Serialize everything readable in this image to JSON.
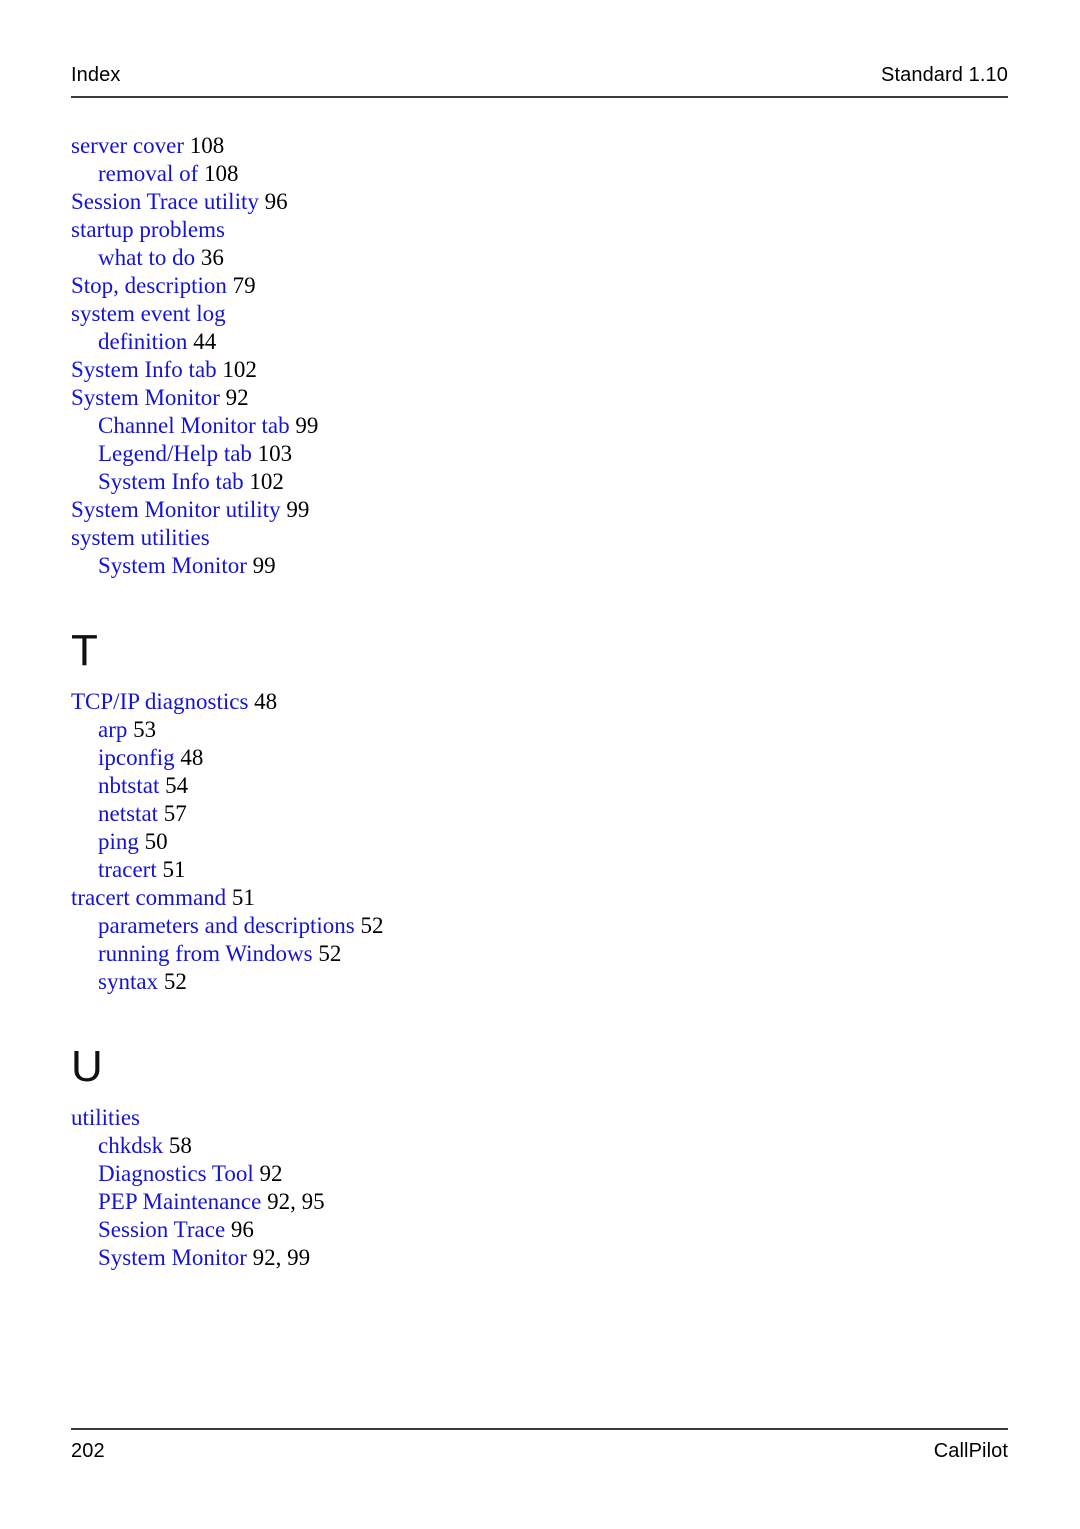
{
  "header": {
    "left": "Index",
    "right": "Standard 1.10"
  },
  "footer": {
    "left": "202",
    "right": "CallPilot"
  },
  "colors": {
    "entry_blue": "#1414d2",
    "page_number_black": "#000000",
    "rule_gray": "#3a3a3a"
  },
  "index": {
    "blocks": [
      {
        "type": "entries",
        "items": [
          {
            "label": "server cover",
            "pages": "108",
            "level": 0
          },
          {
            "label": "removal of",
            "pages": "108",
            "level": 1
          },
          {
            "label": "Session Trace utility",
            "pages": "96",
            "level": 0
          },
          {
            "label": "startup problems",
            "pages": "",
            "level": 0
          },
          {
            "label": "what to do",
            "pages": "36",
            "level": 1
          },
          {
            "label": "Stop, description",
            "pages": "79",
            "level": 0
          },
          {
            "label": "system event log",
            "pages": "",
            "level": 0
          },
          {
            "label": "definition",
            "pages": "44",
            "level": 1
          },
          {
            "label": "System Info tab",
            "pages": "102",
            "level": 0
          },
          {
            "label": "System Monitor",
            "pages": "92",
            "level": 0
          },
          {
            "label": "Channel Monitor tab",
            "pages": "99",
            "level": 1
          },
          {
            "label": "Legend/Help tab",
            "pages": "103",
            "level": 1
          },
          {
            "label": "System Info tab",
            "pages": "102",
            "level": 1
          },
          {
            "label": "System Monitor utility",
            "pages": "99",
            "level": 0
          },
          {
            "label": "system utilities",
            "pages": "",
            "level": 0
          },
          {
            "label": "System Monitor",
            "pages": "99",
            "level": 1
          }
        ]
      },
      {
        "type": "letter",
        "letter": "T"
      },
      {
        "type": "entries",
        "items": [
          {
            "label": "TCP/IP diagnostics",
            "pages": "48",
            "level": 0
          },
          {
            "label": "arp",
            "pages": "53",
            "level": 1
          },
          {
            "label": "ipconfig",
            "pages": "48",
            "level": 1
          },
          {
            "label": "nbtstat",
            "pages": "54",
            "level": 1
          },
          {
            "label": "netstat",
            "pages": "57",
            "level": 1
          },
          {
            "label": "ping",
            "pages": "50",
            "level": 1
          },
          {
            "label": "tracert",
            "pages": "51",
            "level": 1
          },
          {
            "label": "tracert command",
            "pages": "51",
            "level": 0
          },
          {
            "label": "parameters and descriptions",
            "pages": "52",
            "level": 1
          },
          {
            "label": "running from Windows",
            "pages": "52",
            "level": 1
          },
          {
            "label": "syntax",
            "pages": "52",
            "level": 1
          }
        ]
      },
      {
        "type": "letter",
        "letter": "U"
      },
      {
        "type": "entries",
        "items": [
          {
            "label": "utilities",
            "pages": "",
            "level": 0
          },
          {
            "label": "chkdsk",
            "pages": "58",
            "level": 1
          },
          {
            "label": "Diagnostics Tool",
            "pages": "92",
            "level": 1
          },
          {
            "label": "PEP Maintenance",
            "pages": "92, 95",
            "level": 1
          },
          {
            "label": "Session Trace",
            "pages": "96",
            "level": 1
          },
          {
            "label": "System Monitor",
            "pages": "92, 99",
            "level": 1
          }
        ]
      }
    ]
  }
}
